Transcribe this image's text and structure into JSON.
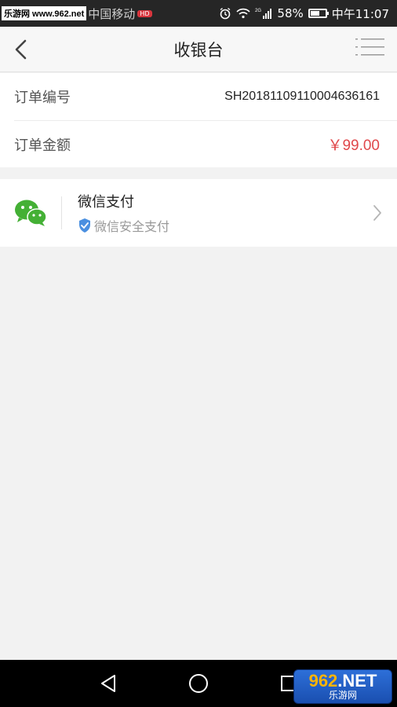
{
  "status_bar": {
    "watermark": "乐游网 www.962.net",
    "carrier": "中国移动",
    "carrier_badge": "HD",
    "network": "2G",
    "battery": "58%",
    "battery_level": 0.58,
    "time": "中午11:07"
  },
  "nav": {
    "title": "收银台"
  },
  "order": {
    "number_label": "订单编号",
    "number_value": "SH2018110911000463616​1",
    "amount_label": "订单金额",
    "amount_value": "￥99.00"
  },
  "payment": {
    "method_title": "微信支付",
    "method_subtitle": "微信安全支付"
  },
  "watermark_logo": {
    "main_a": "962",
    "main_b": ".NET",
    "sub": "乐游网"
  },
  "colors": {
    "accent_red": "#e0484b",
    "wechat_green": "#44b035",
    "shield_blue": "#4a8fe0"
  }
}
